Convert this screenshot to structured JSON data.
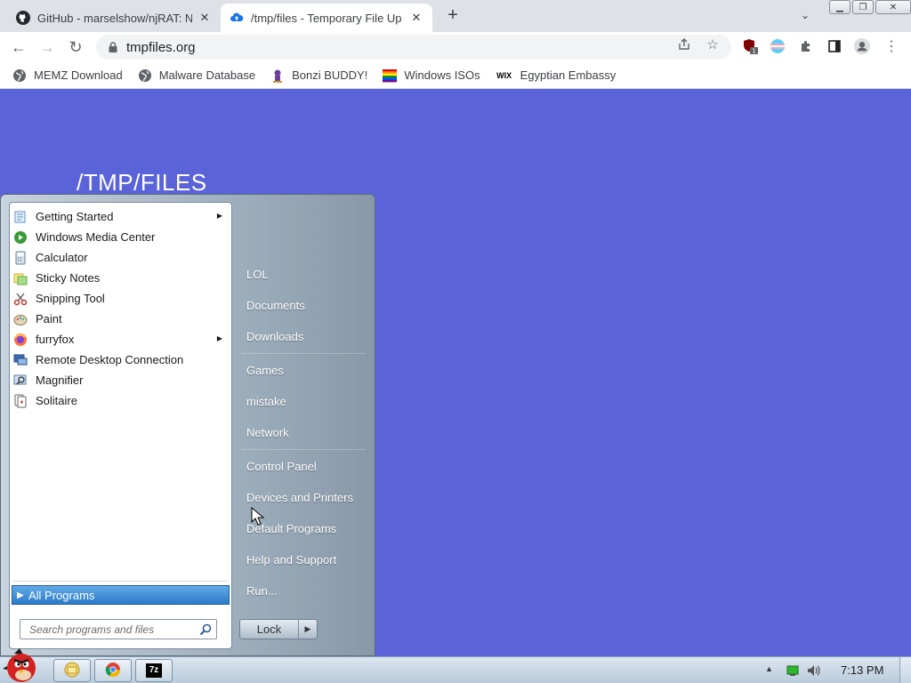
{
  "browser": {
    "tabs": [
      {
        "title": "GitHub - marselshow/njRAT: N",
        "icon": "github-icon",
        "active": false
      },
      {
        "title": "/tmp/files - Temporary File Up",
        "icon": "cloud-upload-icon",
        "active": true
      }
    ],
    "address": "tmpfiles.org",
    "bookmarks": [
      {
        "label": "MEMZ Download",
        "icon": "globe-icon"
      },
      {
        "label": "Malware Database",
        "icon": "globe-icon"
      },
      {
        "label": "Bonzi BUDDY!",
        "icon": "bonzi-icon"
      },
      {
        "label": "Windows ISOs",
        "icon": "rainbow-flag-icon"
      },
      {
        "label": "Egyptian Embassy",
        "icon": "wix-icon"
      }
    ],
    "extension_badge": "1"
  },
  "page": {
    "title": "/TMP/FILES",
    "background": "#5b63d9"
  },
  "start_menu": {
    "programs": [
      {
        "label": "Getting Started",
        "icon": "getting-started-icon",
        "submenu": true
      },
      {
        "label": "Windows Media Center",
        "icon": "media-center-icon",
        "submenu": false
      },
      {
        "label": "Calculator",
        "icon": "calculator-icon",
        "submenu": false
      },
      {
        "label": "Sticky Notes",
        "icon": "sticky-notes-icon",
        "submenu": false
      },
      {
        "label": "Snipping Tool",
        "icon": "snipping-tool-icon",
        "submenu": false
      },
      {
        "label": "Paint",
        "icon": "paint-icon",
        "submenu": false
      },
      {
        "label": "furryfox",
        "icon": "firefox-icon",
        "submenu": true
      },
      {
        "label": "Remote Desktop Connection",
        "icon": "remote-desktop-icon",
        "submenu": false
      },
      {
        "label": "Magnifier",
        "icon": "magnifier-icon",
        "submenu": false
      },
      {
        "label": "Solitaire",
        "icon": "solitaire-icon",
        "submenu": false
      }
    ],
    "all_programs": "All Programs",
    "search_placeholder": "Search programs and files",
    "right_items": [
      {
        "label": "LOL"
      },
      {
        "label": "Documents"
      },
      {
        "label": "Downloads"
      },
      {
        "label": "Games"
      },
      {
        "label": "mistake"
      },
      {
        "label": "Network"
      },
      {
        "label": "Control Panel"
      },
      {
        "label": "Devices and Printers"
      },
      {
        "label": "Default Programs"
      },
      {
        "label": "Help and Support"
      },
      {
        "label": "Run..."
      }
    ],
    "lock_label": "Lock"
  },
  "taskbar": {
    "clock": "7:13 PM",
    "pinned": [
      "explorer-icon",
      "chrome-icon",
      "7zip-icon"
    ],
    "sevenzip_label": "7z"
  }
}
